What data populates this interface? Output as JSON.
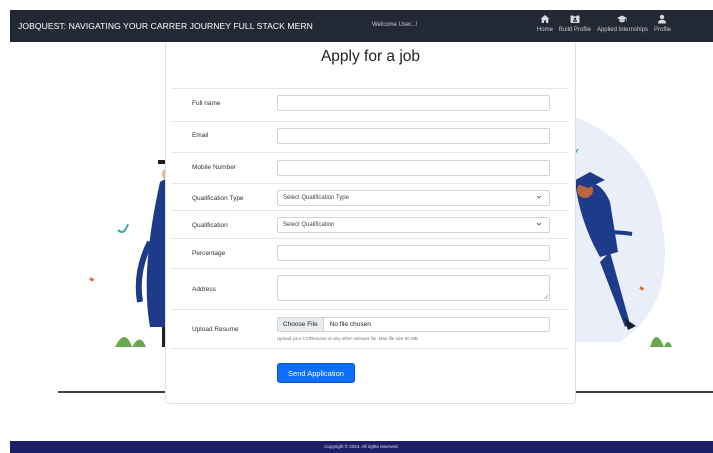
{
  "nav": {
    "brand": "JOBQUEST: NAVIGATING YOUR CARRER JOURNEY FULL STACK MERN",
    "welcome": "Welcome User...!",
    "items": [
      {
        "label": "Home",
        "icon": "home-icon"
      },
      {
        "label": "Build Profile",
        "icon": "id-card-icon"
      },
      {
        "label": "Applied Internships",
        "icon": "graduation-cap-icon"
      },
      {
        "label": "Profile",
        "icon": "user-icon"
      }
    ]
  },
  "form": {
    "title": "Apply for a job",
    "full_name_label": "Full name",
    "email_label": "Email",
    "mobile_label": "Mobile Number",
    "qualification_type_label": "Qualification Type",
    "qualification_type_value": "Select Qualification Type",
    "qualification_label": "Qualification",
    "qualification_value": "Select Qualification",
    "percentage_label": "Percentage",
    "address_label": "Address",
    "resume_label": "Upload Resume",
    "choose_file": "Choose File",
    "no_file": "No file chosen",
    "resume_help": "Upload your CV/Resume or any other relevant file. Max file size 50 MB",
    "submit": "Send Application"
  },
  "footer": {
    "copyright": "Copyright © 2024. All rights reserved."
  },
  "colors": {
    "navbar": "#222934",
    "footer": "#1d1f66",
    "primary_button": "#0d6efd",
    "illustration_blue": "#1e3b8a",
    "illustration_bg": "#e9eef8"
  }
}
